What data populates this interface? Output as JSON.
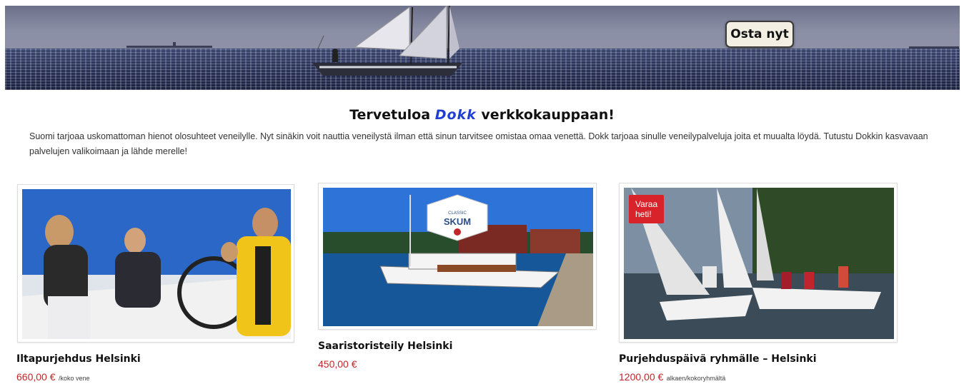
{
  "hero": {
    "buy_button_label": "Osta nyt",
    "image_icon": "sailboat-image"
  },
  "welcome": {
    "title_before": "Tervetuloa",
    "title_brand": "Dokk",
    "title_after": "verkkokauppaan!",
    "intro_text": "Suomi tarjoaa uskomattoman hienot olosuhteet veneilylle. Nyt sinäkin voit nauttia veneilystä ilman että sinun tarvitsee omistaa omaa venettä. Dokk tarjoaa sinulle veneilypalveluja joita et muualta löydä. Tutustu Dokkin kasvavaan palvelujen valikoimaan ja lähde merelle!"
  },
  "colors": {
    "brand_blue": "#1f3fd2",
    "price_red": "#c3262a",
    "badge_red": "#d8232a"
  },
  "products": [
    {
      "title": "Iltapurjehdus Helsinki",
      "price": "660,00 €",
      "price_unit": "/koko vene",
      "image_icon": "sailing-crew-image"
    },
    {
      "title": "Saaristoristeily Helsinki",
      "price": "450,00 €",
      "price_unit": "",
      "image_icon": "motor-yacht-image",
      "image_logo_top": "CLASSIC",
      "image_logo_text": "SKUM"
    },
    {
      "title": "Purjehduspäivä ryhmälle – Helsinki",
      "price": "1200,00 €",
      "price_unit": "alkaen/kokoryhmältä",
      "image_icon": "sailing-race-image",
      "badge": "Varaa heti!"
    }
  ]
}
